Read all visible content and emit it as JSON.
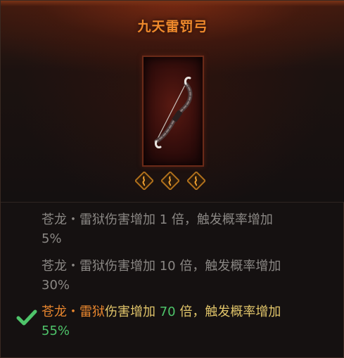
{
  "item": {
    "name": "九天雷罚弓",
    "icon": "bow-icon",
    "socket_icon": "rune-socket-icon",
    "socket_count": 3
  },
  "colors": {
    "title": "#f08a2c",
    "inactive_text": "#8a8784",
    "active_skill": "#e8862e",
    "active_text": "#e0c46a",
    "active_number": "#4ec46a",
    "check": "#4ec46a"
  },
  "effects": [
    {
      "skill": "苍龙・雷狱",
      "text_a": "伤害增加 ",
      "damage": "1",
      "text_b": " 倍，触发概率增加",
      "chance": "5%",
      "active": false
    },
    {
      "skill": "苍龙・雷狱",
      "text_a": "伤害增加 ",
      "damage": "10",
      "text_b": " 倍，触发概率增加",
      "chance": "30%",
      "active": false
    },
    {
      "skill": "苍龙・雷狱",
      "text_a": "伤害增加 ",
      "damage": "70",
      "text_b": " 倍，触发概率增加",
      "chance": "55%",
      "active": true
    }
  ],
  "active_marker_icon": "checkmark-icon"
}
